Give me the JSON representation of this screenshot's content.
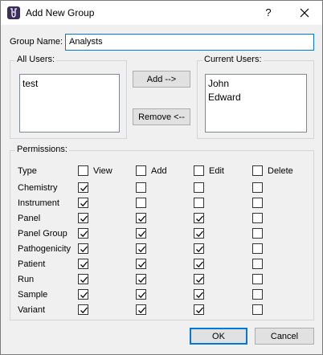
{
  "window": {
    "title": "Add New Group",
    "help_glyph": "?",
    "icon_name": "app-icon",
    "close_icon": "close-icon"
  },
  "group_name": {
    "label": "Group Name:",
    "value": "Analysts"
  },
  "all_users": {
    "title": "All Users:",
    "items": [
      "test"
    ]
  },
  "current_users": {
    "title": "Current Users:",
    "items": [
      "John",
      "Edward"
    ]
  },
  "buttons": {
    "add": "Add -->",
    "remove": "Remove <--",
    "ok": "OK",
    "cancel": "Cancel"
  },
  "permissions": {
    "title": "Permissions:",
    "type_label": "Type",
    "columns": [
      "View",
      "Add",
      "Edit",
      "Delete"
    ],
    "header_checked": [
      false,
      false,
      false,
      false
    ],
    "rows": [
      {
        "name": "Chemistry",
        "checked": [
          true,
          false,
          false,
          false
        ]
      },
      {
        "name": "Instrument",
        "checked": [
          true,
          false,
          false,
          false
        ]
      },
      {
        "name": "Panel",
        "checked": [
          true,
          true,
          true,
          false
        ]
      },
      {
        "name": "Panel Group",
        "checked": [
          true,
          true,
          true,
          false
        ]
      },
      {
        "name": "Pathogenicity",
        "checked": [
          true,
          true,
          true,
          false
        ]
      },
      {
        "name": "Patient",
        "checked": [
          true,
          true,
          true,
          false
        ]
      },
      {
        "name": "Run",
        "checked": [
          true,
          true,
          true,
          false
        ]
      },
      {
        "name": "Sample",
        "checked": [
          true,
          true,
          true,
          false
        ]
      },
      {
        "name": "Variant",
        "checked": [
          true,
          true,
          true,
          false
        ]
      }
    ]
  },
  "colors": {
    "accent": "#0078d7",
    "button_face": "#e1e1e1",
    "dialog_bg": "#f0f0f0"
  }
}
